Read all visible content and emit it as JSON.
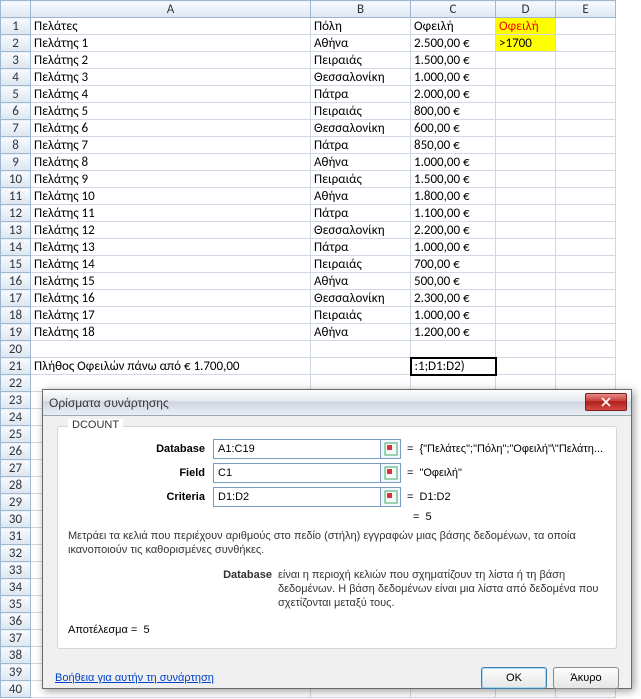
{
  "columns": [
    "A",
    "B",
    "C",
    "D",
    "E"
  ],
  "headers": {
    "A": "Πελάτες",
    "B": "Πόλη",
    "C": "Οφειλή",
    "D": "Οφειλή"
  },
  "criteria_value": ">1700",
  "rows": [
    {
      "n": 1,
      "A": "Πελάτης 1",
      "B": "Αθήνα",
      "C": "2.500,00 €"
    },
    {
      "n": 2,
      "A": "Πελάτης 2",
      "B": "Πειραιάς",
      "C": "1.500,00 €"
    },
    {
      "n": 3,
      "A": "Πελάτης 3",
      "B": "Θεσσαλονίκη",
      "C": "1.000,00 €"
    },
    {
      "n": 4,
      "A": "Πελάτης 4",
      "B": "Πάτρα",
      "C": "2.000,00 €"
    },
    {
      "n": 5,
      "A": "Πελάτης 5",
      "B": "Πειραιάς",
      "C": "800,00 €"
    },
    {
      "n": 6,
      "A": "Πελάτης 6",
      "B": "Θεσσαλονίκη",
      "C": "600,00 €"
    },
    {
      "n": 7,
      "A": "Πελάτης 7",
      "B": "Πάτρα",
      "C": "850,00 €"
    },
    {
      "n": 8,
      "A": "Πελάτης 8",
      "B": "Αθήνα",
      "C": "1.000,00 €"
    },
    {
      "n": 9,
      "A": "Πελάτης 9",
      "B": "Πειραιάς",
      "C": "1.500,00 €"
    },
    {
      "n": 10,
      "A": "Πελάτης 10",
      "B": "Αθήνα",
      "C": "1.800,00 €"
    },
    {
      "n": 11,
      "A": "Πελάτης 11",
      "B": "Πάτρα",
      "C": "1.100,00 €"
    },
    {
      "n": 12,
      "A": "Πελάτης 12",
      "B": "Θεσσαλονίκη",
      "C": "2.200,00 €"
    },
    {
      "n": 13,
      "A": "Πελάτης 13",
      "B": "Πάτρα",
      "C": "1.000,00 €"
    },
    {
      "n": 14,
      "A": "Πελάτης 14",
      "B": "Πειραιάς",
      "C": "700,00 €"
    },
    {
      "n": 15,
      "A": "Πελάτης 15",
      "B": "Αθήνα",
      "C": "500,00 €"
    },
    {
      "n": 16,
      "A": "Πελάτης 16",
      "B": "Θεσσαλονίκη",
      "C": "2.300,00 €"
    },
    {
      "n": 17,
      "A": "Πελάτης 17",
      "B": "Πειραιάς",
      "C": "1.000,00 €"
    },
    {
      "n": 18,
      "A": "Πελάτης 18",
      "B": "Αθήνα",
      "C": "1.200,00 €"
    }
  ],
  "summary_label": "Πλήθος Οφειλών πάνω από € 1.700,00",
  "formula_cell_display": ":1;D1:D2)",
  "dialog": {
    "title": "Ορίσματα συνάρτησης",
    "function_name": "DCOUNT",
    "fields": {
      "database": {
        "label": "Database",
        "input": "A1:C19",
        "value": "{\"Πελάτες\";\"Πόλη\";\"Οφειλή\"\\\"Πελάτη..."
      },
      "field": {
        "label": "Field",
        "input": "C1",
        "value": "\"Οφειλή\""
      },
      "criteria": {
        "label": "Criteria",
        "input": "D1:D2",
        "value": "D1:D2"
      }
    },
    "equals_value": "5",
    "description": "Μετράει τα κελιά που περιέχουν αριθμούς στο πεδίο (στήλη) εγγραφών μιας βάσης δεδομένων, τα οποία ικανοποιούν τις καθορισμένες συνθήκες.",
    "arg_label": "Database",
    "arg_desc": "είναι η περιοχή κελιών που σχηματίζουν τη λίστα ή τη βάση δεδομένων. Η βάση δεδομένων είναι μια λίστα από δεδομένα που σχετίζονται μεταξύ τους.",
    "result_label": "Αποτέλεσμα  =",
    "result_value": "5",
    "help_link": "Βοήθεια για αυτήν τη συνάρτηση",
    "ok": "OK",
    "cancel": "Άκυρο"
  }
}
